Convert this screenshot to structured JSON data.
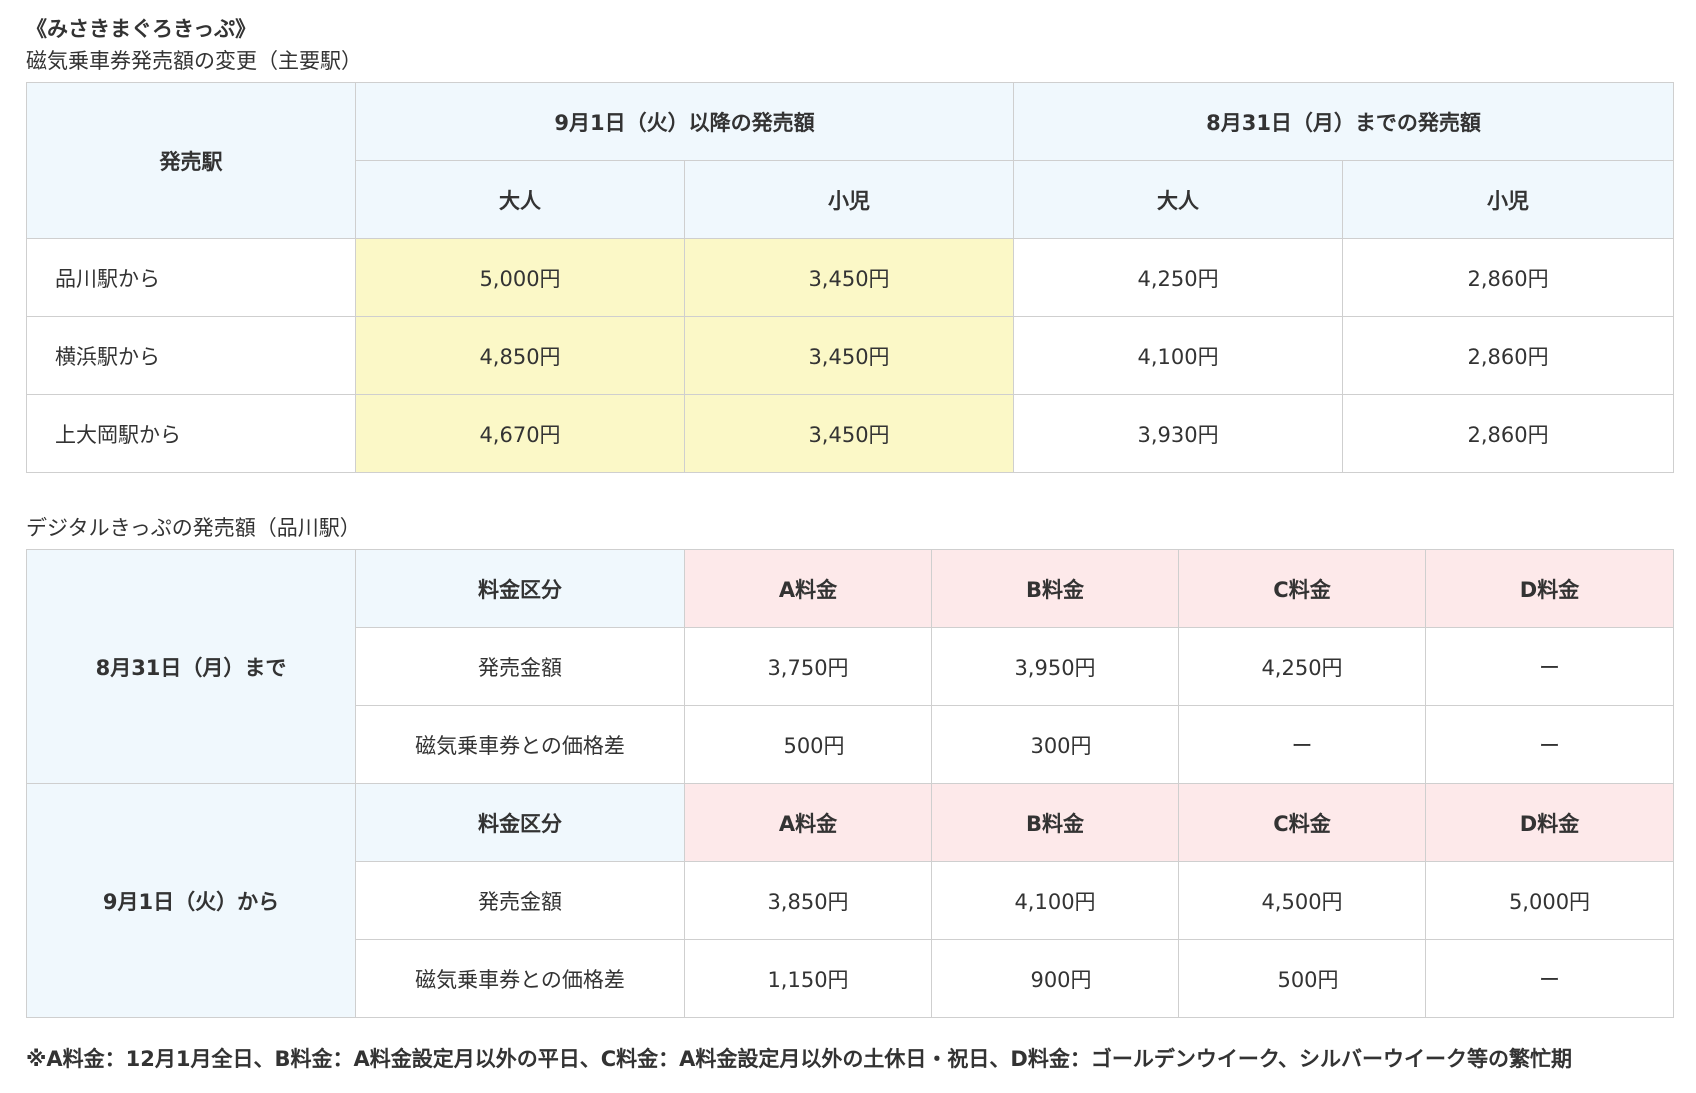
{
  "title": "《みさきまぐろきっぷ》",
  "magnetic": {
    "label": "磁気乗車券発売額の変更（主要駅）",
    "header": {
      "station": "発売駅",
      "after": "9月1日（火）以降の発売額",
      "before": "8月31日（月）までの発売額",
      "adult": "大人",
      "child": "小児"
    },
    "rows": [
      {
        "station": "品川駅から",
        "after_adult": "5,000円",
        "after_child": "3,450円",
        "before_adult": "4,250円",
        "before_child": "2,860円"
      },
      {
        "station": "横浜駅から",
        "after_adult": "4,850円",
        "after_child": "3,450円",
        "before_adult": "4,100円",
        "before_child": "2,860円"
      },
      {
        "station": "上大岡駅から",
        "after_adult": "4,670円",
        "after_child": "3,450円",
        "before_adult": "3,930円",
        "before_child": "2,860円"
      }
    ]
  },
  "digital": {
    "label": "デジタルきっぷの発売額（品川駅）",
    "groups": [
      {
        "period": "8月31日（月）まで",
        "fare_class": "料金区分",
        "fares": [
          "A料金",
          "B料金",
          "C料金",
          "D料金"
        ],
        "price_label": "発売金額",
        "prices": [
          "3,750円",
          "3,950円",
          "4,250円",
          "ー"
        ],
        "diff_label": "磁気乗車券との価格差",
        "diffs": [
          "500円",
          "300円",
          "ー",
          "ー"
        ]
      },
      {
        "period": "9月1日（火）から",
        "fare_class": "料金区分",
        "fares": [
          "A料金",
          "B料金",
          "C料金",
          "D料金"
        ],
        "price_label": "発売金額",
        "prices": [
          "3,850円",
          "4,100円",
          "4,500円",
          "5,000円"
        ],
        "diff_label": "磁気乗車券との価格差",
        "diffs": [
          "1,150円",
          "900円",
          "500円",
          "ー"
        ]
      }
    ]
  },
  "note": "※A料金：12月1月全日、B料金：A料金設定月以外の平日、C料金：A料金設定月以外の土休日・祝日、D料金：ゴールデンウイーク、シルバーウイーク等の繁忙期",
  "colors": {
    "header_bg": "#f0f8fd",
    "highlight_yellow": "#fbf8c7",
    "highlight_pink": "#fde9ea",
    "border": "#cfcfcf"
  }
}
